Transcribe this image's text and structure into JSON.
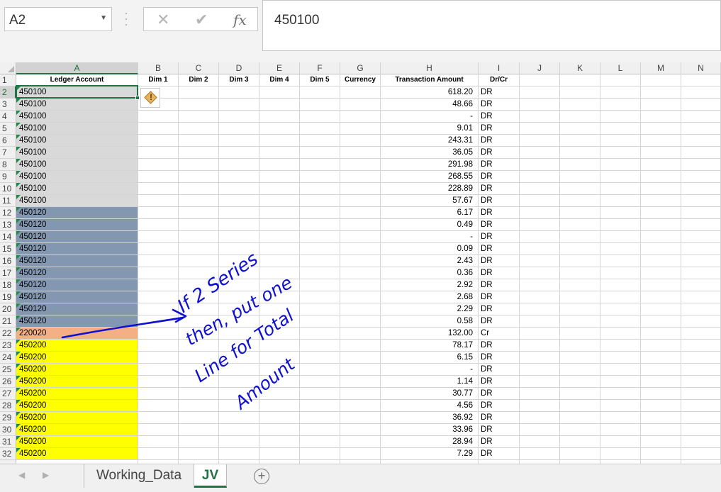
{
  "formula_bar": {
    "name_box": "A2",
    "cancel_icon": "✕",
    "enter_icon": "✔",
    "fx_label": "fx",
    "formula_value": "450100"
  },
  "columns": [
    {
      "letter": "A",
      "header": "Ledger Account"
    },
    {
      "letter": "B",
      "header": "Dim 1"
    },
    {
      "letter": "C",
      "header": "Dim 2"
    },
    {
      "letter": "D",
      "header": "Dim 3"
    },
    {
      "letter": "E",
      "header": "Dim 4"
    },
    {
      "letter": "F",
      "header": "Dim 5"
    },
    {
      "letter": "G",
      "header": "Currency"
    },
    {
      "letter": "H",
      "header": "Transaction Amount"
    },
    {
      "letter": "I",
      "header": "Dr/Cr"
    },
    {
      "letter": "J",
      "header": ""
    },
    {
      "letter": "K",
      "header": ""
    },
    {
      "letter": "L",
      "header": ""
    },
    {
      "letter": "M",
      "header": ""
    },
    {
      "letter": "N",
      "header": ""
    }
  ],
  "fill_colors": {
    "gray": "#d9d9d9",
    "blue_gray": "#8497b0",
    "salmon": "#f4b084",
    "yellow": "#ffff00"
  },
  "rows": [
    {
      "n": "2",
      "account": "450100",
      "amount": "618.20",
      "drcr": "DR",
      "fill": "gray"
    },
    {
      "n": "3",
      "account": "450100",
      "amount": "48.66",
      "drcr": "DR",
      "fill": "gray"
    },
    {
      "n": "4",
      "account": "450100",
      "amount": "-",
      "drcr": "DR",
      "fill": "gray"
    },
    {
      "n": "5",
      "account": "450100",
      "amount": "9.01",
      "drcr": "DR",
      "fill": "gray"
    },
    {
      "n": "6",
      "account": "450100",
      "amount": "243.31",
      "drcr": "DR",
      "fill": "gray"
    },
    {
      "n": "7",
      "account": "450100",
      "amount": "36.05",
      "drcr": "DR",
      "fill": "gray"
    },
    {
      "n": "8",
      "account": "450100",
      "amount": "291.98",
      "drcr": "DR",
      "fill": "gray"
    },
    {
      "n": "9",
      "account": "450100",
      "amount": "268.55",
      "drcr": "DR",
      "fill": "gray"
    },
    {
      "n": "10",
      "account": "450100",
      "amount": "228.89",
      "drcr": "DR",
      "fill": "gray"
    },
    {
      "n": "11",
      "account": "450100",
      "amount": "57.67",
      "drcr": "DR",
      "fill": "gray"
    },
    {
      "n": "12",
      "account": "450120",
      "amount": "6.17",
      "drcr": "DR",
      "fill": "blue_gray"
    },
    {
      "n": "13",
      "account": "450120",
      "amount": "0.49",
      "drcr": "DR",
      "fill": "blue_gray"
    },
    {
      "n": "14",
      "account": "450120",
      "amount": "-",
      "drcr": "DR",
      "fill": "blue_gray"
    },
    {
      "n": "15",
      "account": "450120",
      "amount": "0.09",
      "drcr": "DR",
      "fill": "blue_gray"
    },
    {
      "n": "16",
      "account": "450120",
      "amount": "2.43",
      "drcr": "DR",
      "fill": "blue_gray"
    },
    {
      "n": "17",
      "account": "450120",
      "amount": "0.36",
      "drcr": "DR",
      "fill": "blue_gray"
    },
    {
      "n": "18",
      "account": "450120",
      "amount": "2.92",
      "drcr": "DR",
      "fill": "blue_gray"
    },
    {
      "n": "19",
      "account": "450120",
      "amount": "2.68",
      "drcr": "DR",
      "fill": "blue_gray"
    },
    {
      "n": "20",
      "account": "450120",
      "amount": "2.29",
      "drcr": "DR",
      "fill": "blue_gray"
    },
    {
      "n": "21",
      "account": "450120",
      "amount": "0.58",
      "drcr": "DR",
      "fill": "blue_gray"
    },
    {
      "n": "22",
      "account": "220020",
      "amount": "132.00",
      "drcr": "Cr",
      "fill": "salmon"
    },
    {
      "n": "23",
      "account": "450200",
      "amount": "78.17",
      "drcr": "DR",
      "fill": "yellow"
    },
    {
      "n": "24",
      "account": "450200",
      "amount": "6.15",
      "drcr": "DR",
      "fill": "yellow"
    },
    {
      "n": "25",
      "account": "450200",
      "amount": "-",
      "drcr": "DR",
      "fill": "yellow"
    },
    {
      "n": "26",
      "account": "450200",
      "amount": "1.14",
      "drcr": "DR",
      "fill": "yellow"
    },
    {
      "n": "27",
      "account": "450200",
      "amount": "30.77",
      "drcr": "DR",
      "fill": "yellow"
    },
    {
      "n": "28",
      "account": "450200",
      "amount": "4.56",
      "drcr": "DR",
      "fill": "yellow"
    },
    {
      "n": "29",
      "account": "450200",
      "amount": "36.92",
      "drcr": "DR",
      "fill": "yellow"
    },
    {
      "n": "30",
      "account": "450200",
      "amount": "33.96",
      "drcr": "DR",
      "fill": "yellow"
    },
    {
      "n": "31",
      "account": "450200",
      "amount": "28.94",
      "drcr": "DR",
      "fill": "yellow"
    },
    {
      "n": "32",
      "account": "450200",
      "amount": "7.29",
      "drcr": "DR",
      "fill": "yellow"
    }
  ],
  "annotation": {
    "color": "#1010d0",
    "lines": [
      "If 2 Series",
      "then, put one",
      "Line for Total",
      "Amount"
    ]
  },
  "sheet_tabs": {
    "tabs": [
      "Working_Data",
      "JV"
    ],
    "active": "JV",
    "add_icon": "+"
  }
}
